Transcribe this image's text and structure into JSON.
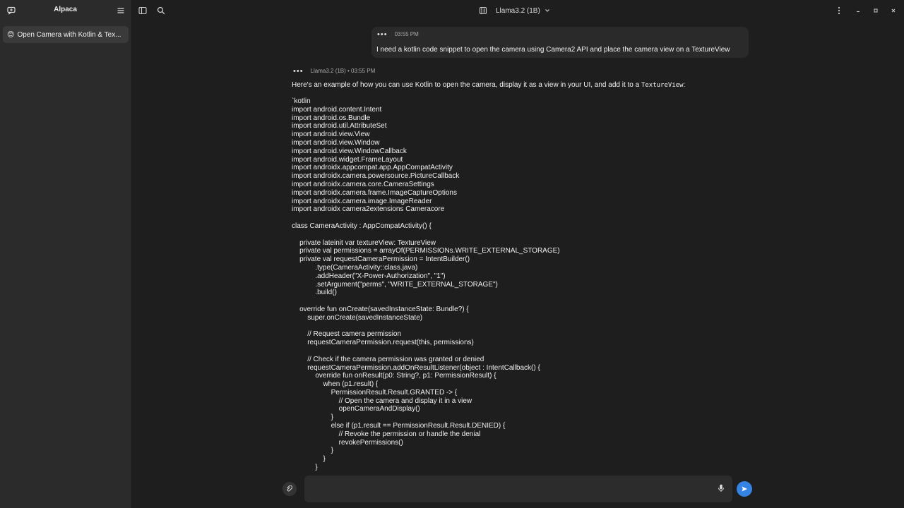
{
  "sidebar": {
    "title": "Alpaca",
    "chats": [
      {
        "emoji": "😊",
        "label": "Open Camera with Kotlin & Tex..."
      }
    ]
  },
  "topbar": {
    "model": "Llama3.2 (1B)"
  },
  "messages": {
    "user": {
      "time": "03:55 PM",
      "text": "I need a kotlin code snippet to open the camera using Camera2 API and place the camera view on a TextureView"
    },
    "bot": {
      "meta": "Llama3.2 (1B) • 03:55 PM",
      "intro": "Here's an example of how you can use Kotlin to open the camera, display it as a view in your UI, and add it to a ",
      "intro_code": "TextureView",
      "intro_end": ":",
      "code": "`kotlin\nimport android.content.Intent\nimport android.os.Bundle\nimport android.util.AttributeSet\nimport android.view.View\nimport android.view.Window\nimport android.view.WindowCallback\nimport android.widget.FrameLayout\nimport androidx.appcompat.app.AppCompatActivity\nimport androidx.camera.powersource.PictureCallback\nimport androidx.camera.core.CameraSettings\nimport androidx.camera.frame.ImageCaptureOptions\nimport androidx.camera.image.ImageReader\nimport androidx camera2extensions Cameracore\n\nclass CameraActivity : AppCompatActivity() {\n\n    private lateinit var textureView: TextureView\n    private val permissions = arrayOf(PERMISSIONs.WRITE_EXTERNAL_STORAGE)\n    private val requestCameraPermission = IntentBuilder()\n            .type(CameraActivity::class.java)\n            .addHeader(\"X-Power-Authorization\", \"1\")\n            .setArgument(\"perms\", \"WRITE_EXTERNAL_STORAGE\")\n            .build()\n\n    override fun onCreate(savedInstanceState: Bundle?) {\n        super.onCreate(savedInstanceState)\n\n        // Request camera permission\n        requestCameraPermission.request(this, permissions)\n\n        // Check if the camera permission was granted or denied\n        requestCameraPermission.addOnResultListener(object : IntentCallback() {\n            override fun onResult(p0: String?, p1: PermissionResult) {\n                when (p1.result) {\n                    PermissionResult.Result.GRANTED -> {\n                        // Open the camera and display it in a view\n                        openCameraAndDisplay()\n                    }\n                    else if (p1.result == PermissionResult.Result.DENIED) {\n                        // Revoke the permission or handle the denial\n                        revokePermissions()\n                    }\n                }\n            }"
    }
  },
  "input": {
    "placeholder": ""
  },
  "colors": {
    "accent": "#3584e4",
    "sidebar_bg": "#2b2b2b",
    "main_bg": "#1e1e1e"
  }
}
